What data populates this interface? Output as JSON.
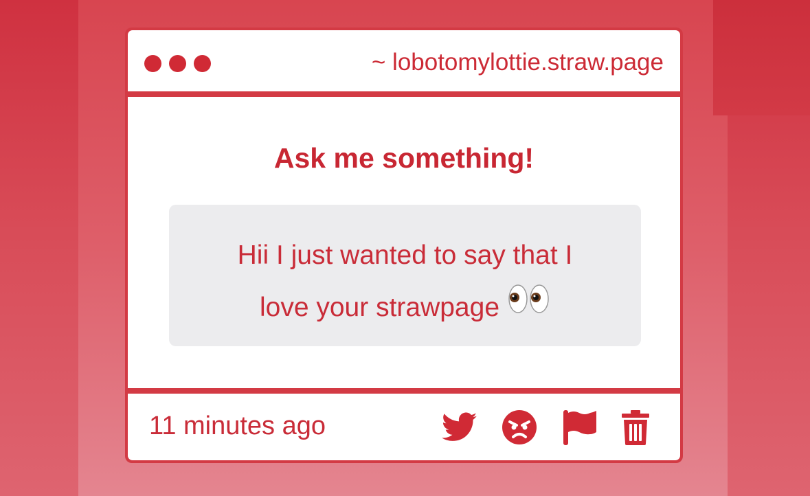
{
  "header": {
    "url": "~ lobotomylottie.straw.page",
    "window_dots": [
      "dot-1",
      "dot-2",
      "dot-3"
    ]
  },
  "main": {
    "heading": "Ask me something!",
    "message_line1": "Hii I just wanted to say that I",
    "message_line2": "love your strawpage",
    "message_emoji": "eyes-emoji"
  },
  "footer": {
    "timestamp": "11 minutes ago",
    "actions": [
      {
        "name": "share-twitter-button",
        "icon": "twitter-bird-icon"
      },
      {
        "name": "angry-react-button",
        "icon": "angry-face-icon"
      },
      {
        "name": "report-button",
        "icon": "flag-icon"
      },
      {
        "name": "delete-button",
        "icon": "trash-icon"
      }
    ]
  },
  "colors": {
    "accent": "#d02a35",
    "background": "#d84b57",
    "message_box": "#ececee"
  }
}
